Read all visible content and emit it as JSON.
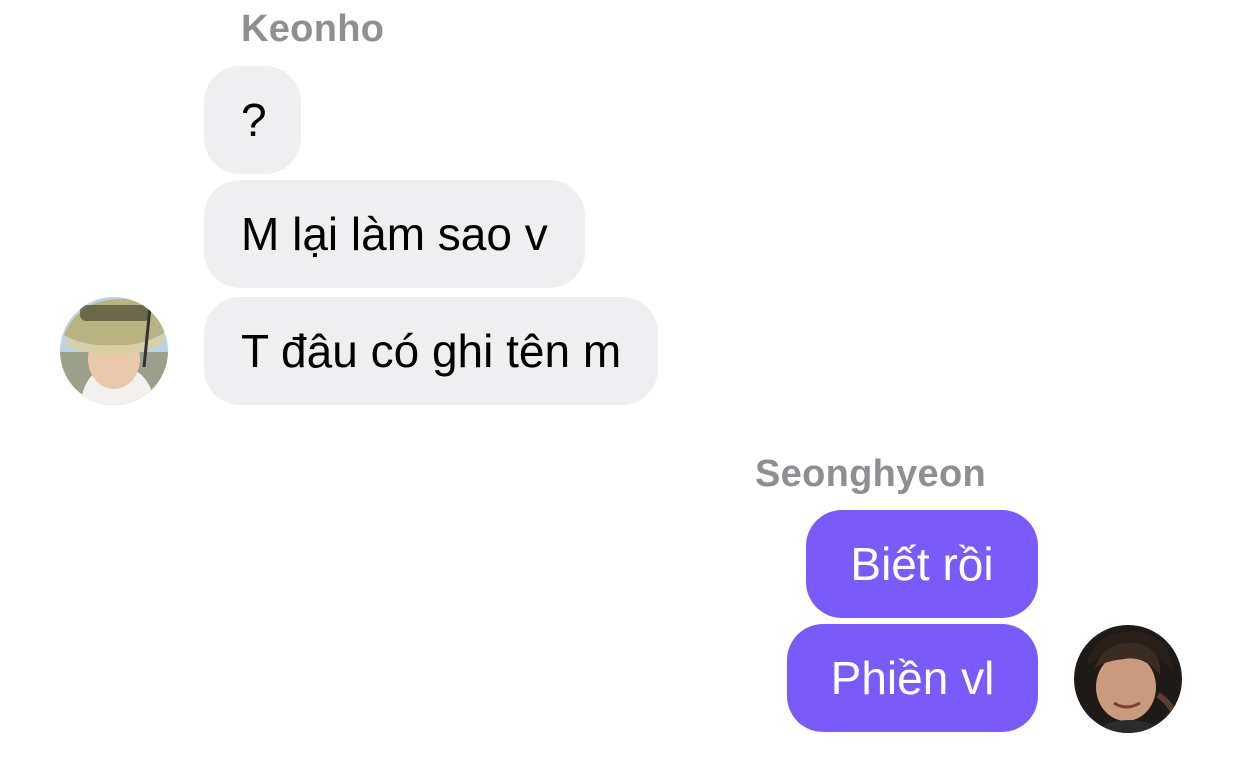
{
  "colors": {
    "incoming_bubble": "#efeff2",
    "outgoing_bubble": "#7a5af8",
    "sender_name": "#8e8e93"
  },
  "incoming_group": {
    "sender": "Keonho",
    "avatar_icon": "user-photo-avatar",
    "messages": [
      {
        "text": "?"
      },
      {
        "text": "M lại làm sao v"
      },
      {
        "text": "T đâu có ghi tên m"
      }
    ]
  },
  "outgoing_group": {
    "sender": "Seonghyeon",
    "avatar_icon": "user-photo-avatar",
    "messages": [
      {
        "text": "Biết rồi"
      },
      {
        "text": "Phiền vl"
      }
    ]
  }
}
